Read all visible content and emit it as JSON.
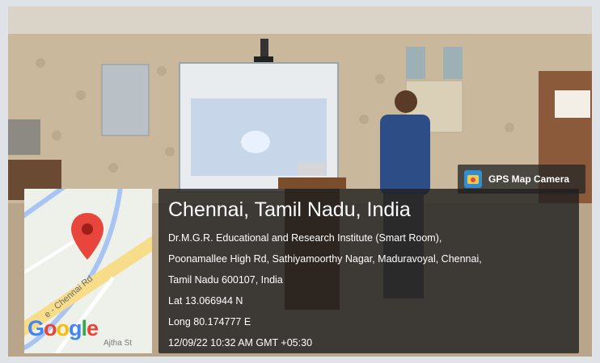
{
  "badge": {
    "label": "GPS Map Camera",
    "icon": "camera-app-icon"
  },
  "location": {
    "city": "Chennai, Tamil Nadu, India",
    "address_line1": "Dr.M.G.R. Educational and Research Institute (Smart Room),",
    "address_line2": "Poonamallee High Rd, Sathiyamoorthy Nagar, Maduravoyal, Chennai,",
    "address_line3": "Tamil Nadu 600107, India",
    "latitude": "Lat 13.066944 N",
    "longitude": "Long 80.174777 E",
    "timestamp": "12/09/22 10:32 AM GMT +05:30"
  },
  "map": {
    "road_label": "e - Chennai Rd",
    "street_label": "Ajtha St",
    "logo_text": [
      "G",
      "o",
      "o",
      "g",
      "l",
      "e"
    ],
    "logo_colors": [
      "#4285F4",
      "#EA4335",
      "#FBBC05",
      "#4285F4",
      "#34A853",
      "#EA4335"
    ],
    "pin_color": "#e8453c"
  }
}
